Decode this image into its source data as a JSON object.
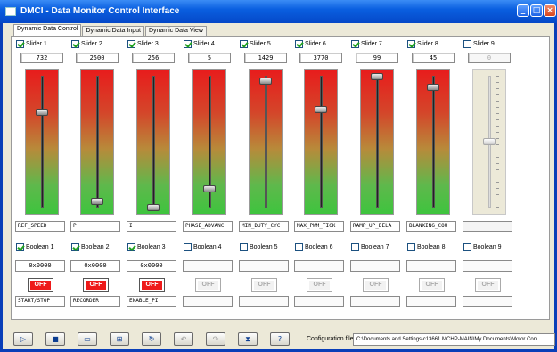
{
  "window": {
    "title": "DMCI - Data Monitor Control Interface",
    "min_glyph": "_",
    "max_glyph": "□",
    "close_glyph": "×"
  },
  "tabs": [
    {
      "label": "Dynamic Data Control",
      "active": true
    },
    {
      "label": "Dynamic Data Input",
      "active": false
    },
    {
      "label": "Dynamic Data View",
      "active": false
    }
  ],
  "sliders": [
    {
      "label": "Slider 1",
      "checked": true,
      "value": "732",
      "level": 0.72,
      "name": "REF_SPEED"
    },
    {
      "label": "Slider 2",
      "checked": true,
      "value": "2500",
      "level": 0.05,
      "name": "P"
    },
    {
      "label": "Slider 3",
      "checked": true,
      "value": "256",
      "level": 0.0,
      "name": "I"
    },
    {
      "label": "Slider 4",
      "checked": true,
      "value": "5",
      "level": 0.14,
      "name": "PHASE_ADVANC"
    },
    {
      "label": "Slider 5",
      "checked": true,
      "value": "1429",
      "level": 0.96,
      "name": "MIN_DUTY_CYC"
    },
    {
      "label": "Slider 6",
      "checked": true,
      "value": "3770",
      "level": 0.74,
      "name": "MAX_PWM_TICK"
    },
    {
      "label": "Slider 7",
      "checked": true,
      "value": "99",
      "level": 0.99,
      "name": "RAMP_UP_DELA"
    },
    {
      "label": "Slider 8",
      "checked": true,
      "value": "45",
      "level": 0.91,
      "name": "BLANKING_COU"
    },
    {
      "label": "Slider 9",
      "checked": false,
      "value": "0",
      "level": 0.5,
      "name": ""
    }
  ],
  "booleans": [
    {
      "label": "Boolean 1",
      "checked": true,
      "hex": "0x0000",
      "button": "OFF",
      "command": "START/STOP"
    },
    {
      "label": "Boolean 2",
      "checked": true,
      "hex": "0x0000",
      "button": "OFF",
      "command": "RECORDER"
    },
    {
      "label": "Boolean 3",
      "checked": true,
      "hex": "0x0000",
      "button": "OFF",
      "command": "ENABLE_PI"
    },
    {
      "label": "Boolean 4",
      "checked": false,
      "hex": "",
      "button": "OFF",
      "command": ""
    },
    {
      "label": "Boolean 5",
      "checked": false,
      "hex": "",
      "button": "OFF",
      "command": ""
    },
    {
      "label": "Boolean 6",
      "checked": false,
      "hex": "",
      "button": "OFF",
      "command": ""
    },
    {
      "label": "Boolean 7",
      "checked": false,
      "hex": "",
      "button": "OFF",
      "command": ""
    },
    {
      "label": "Boolean 8",
      "checked": false,
      "hex": "",
      "button": "OFF",
      "command": ""
    },
    {
      "label": "Boolean 9",
      "checked": false,
      "hex": "",
      "button": "OFF",
      "command": ""
    }
  ],
  "toolbar": [
    {
      "icon": "play-icon",
      "glyph": "▷",
      "enabled": true
    },
    {
      "icon": "save-icon",
      "glyph": "■",
      "enabled": true
    },
    {
      "icon": "open-folder-icon",
      "glyph": "▭",
      "enabled": true
    },
    {
      "icon": "grid-view-icon",
      "glyph": "⊞",
      "enabled": true
    },
    {
      "icon": "refresh-icon",
      "glyph": "↻",
      "enabled": true
    },
    {
      "icon": "undo-icon",
      "glyph": "↶",
      "enabled": false
    },
    {
      "icon": "redo-icon",
      "glyph": "↷",
      "enabled": false
    },
    {
      "icon": "debug-icon",
      "glyph": "⧗",
      "enabled": true
    },
    {
      "icon": "help-icon",
      "glyph": "?",
      "enabled": true
    }
  ],
  "config": {
    "label": "Configuration file:",
    "path": "C:\\Documents and Settings\\c13661.MCHP-MAIN\\My Documents\\Motor Con"
  },
  "colors": {
    "title_bar": "#0a5fe0",
    "slider_top": "#e81c1c",
    "slider_bottom": "#3ec43e",
    "off_button": "#ee1a1a"
  }
}
